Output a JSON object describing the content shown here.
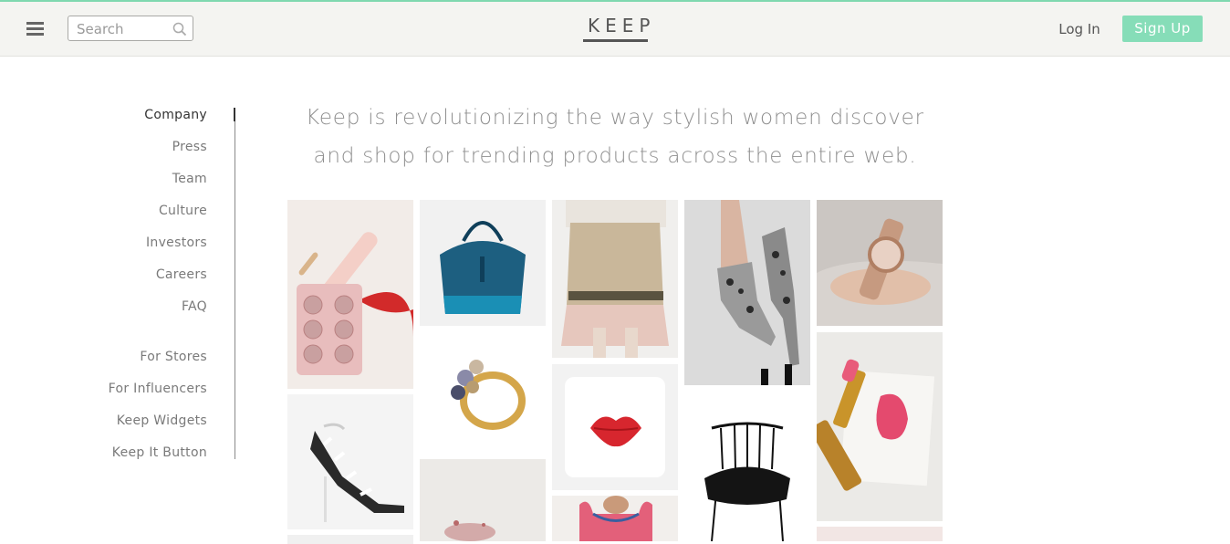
{
  "header": {
    "menu_icon": "hamburger-menu-icon",
    "search_placeholder": "Search",
    "search_icon": "search-icon",
    "logo_text": "KEEP",
    "login_label": "Log In",
    "signup_label": "Sign Up"
  },
  "colors": {
    "accent": "#86ddb8",
    "top_line": "#7fd8b0",
    "header_bg": "#f4f4f1"
  },
  "sidenav": {
    "items": [
      {
        "label": "Company",
        "active": true
      },
      {
        "label": "Press"
      },
      {
        "label": "Team"
      },
      {
        "label": "Culture"
      },
      {
        "label": "Investors"
      },
      {
        "label": "Careers"
      },
      {
        "label": "FAQ"
      },
      {
        "label": "For Stores"
      },
      {
        "label": "For Influencers"
      },
      {
        "label": "Keep Widgets"
      },
      {
        "label": "Keep It Button"
      }
    ]
  },
  "main": {
    "tagline_line1": "Keep is revolutionizing the way stylish women discover",
    "tagline_line2": "and shop for trending products across the entire web."
  }
}
